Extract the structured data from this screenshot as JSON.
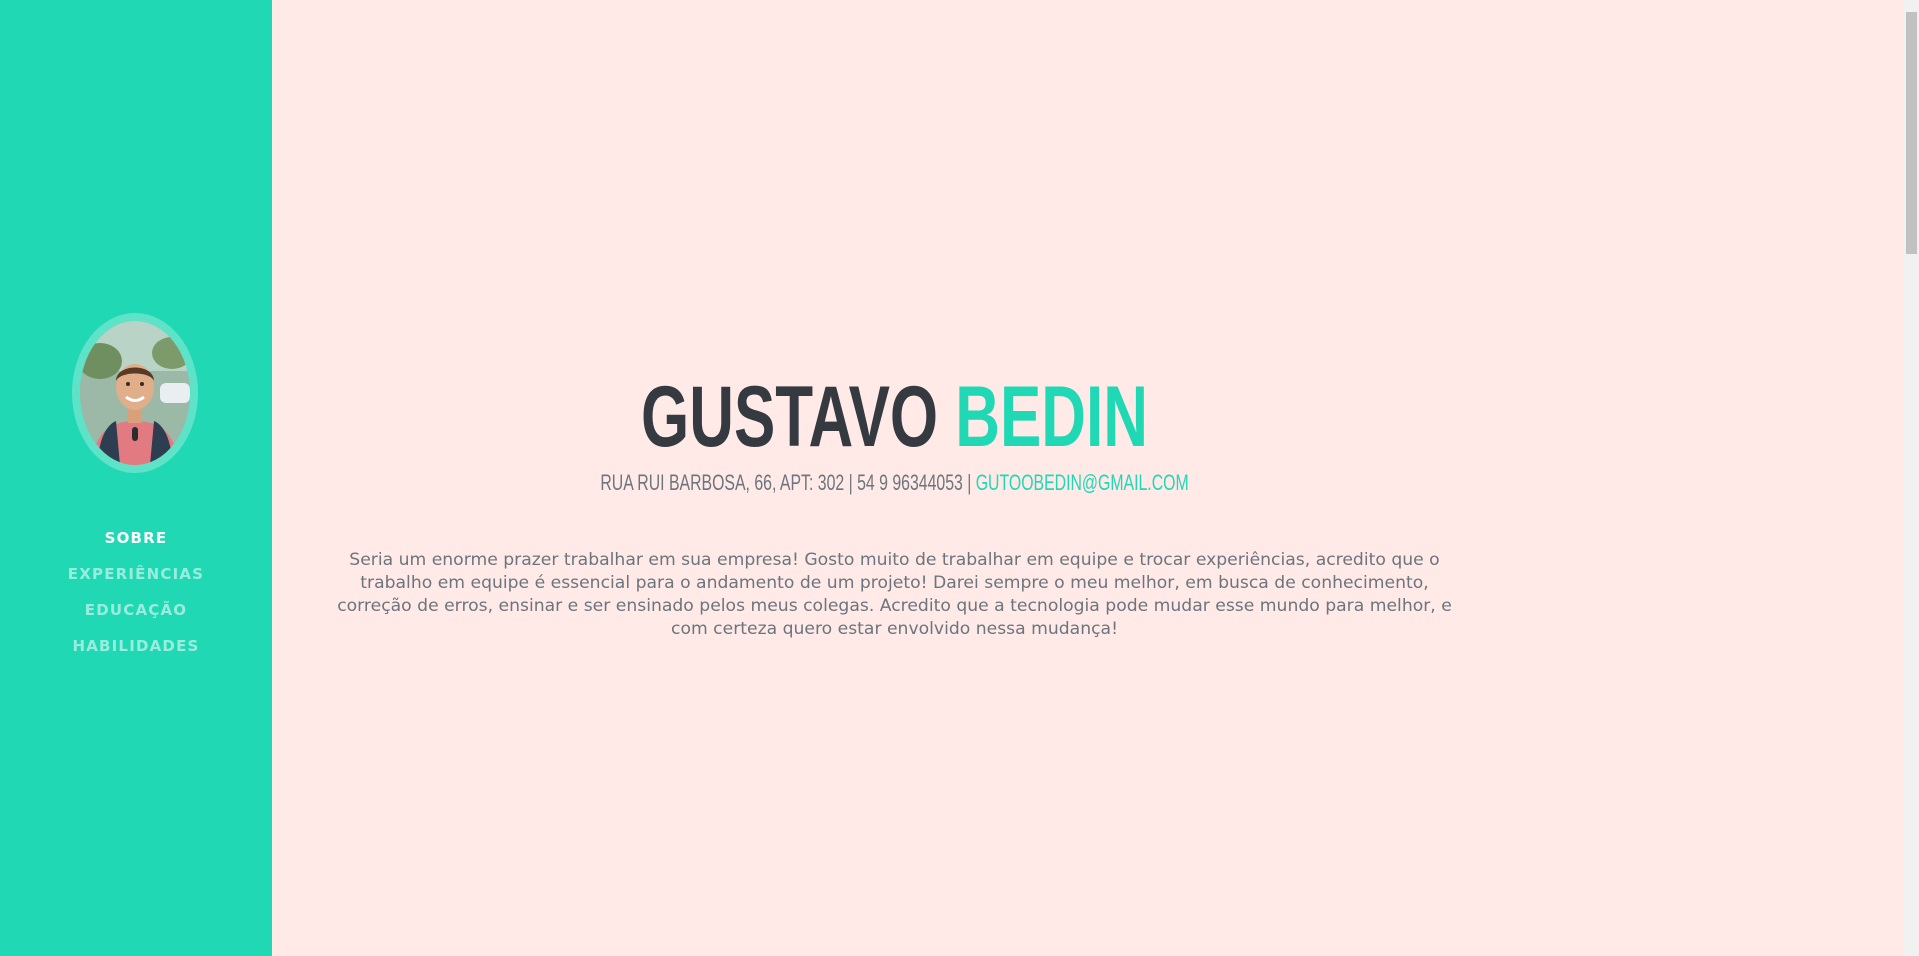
{
  "sidebar": {
    "avatar_icon": "profile-photo",
    "nav": [
      {
        "label": "SOBRE",
        "active": true
      },
      {
        "label": "EXPERIÊNCIAS",
        "active": false
      },
      {
        "label": "EDUCAÇÃO",
        "active": false
      },
      {
        "label": "HABILIDADES",
        "active": false
      }
    ]
  },
  "header": {
    "first_name": "GUSTAVO",
    "last_name": "BEDIN",
    "address": "RUA RUI BARBOSA, 66, APT: 302 | 54 9 96344053 | ",
    "email": "GUTOOBEDIN@GMAIL.COM"
  },
  "about": {
    "text": "Seria um enorme prazer trabalhar em sua empresa! Gosto muito de trabalhar em equipe e trocar experiências, acredito que o trabalho em equipe é essencial para o andamento de um projeto! Darei sempre o meu melhor, em busca de conhecimento, correção de erros, ensinar e ser ensinado pelos meus colegas. Acredito que a tecnologia pode mudar esse mundo para melhor, e com certeza quero estar envolvido nessa mudança!"
  },
  "colors": {
    "primary": "#21d8b5",
    "background": "#ffeae8",
    "heading": "#343a40",
    "text": "#6c757d"
  }
}
